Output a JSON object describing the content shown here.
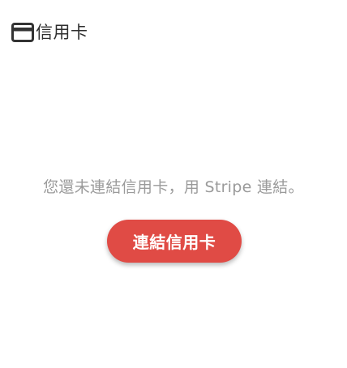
{
  "header": {
    "icon": "credit-card-icon",
    "title": "信用卡"
  },
  "empty_state": {
    "message": "您還未連結信用卡，用 Stripe 連結。"
  },
  "actions": {
    "connect_label": "連結信用卡"
  },
  "colors": {
    "accent": "#e04b45",
    "title_text": "#2f2f2f",
    "muted_text": "#9a9a9a",
    "background": "#ffffff"
  }
}
